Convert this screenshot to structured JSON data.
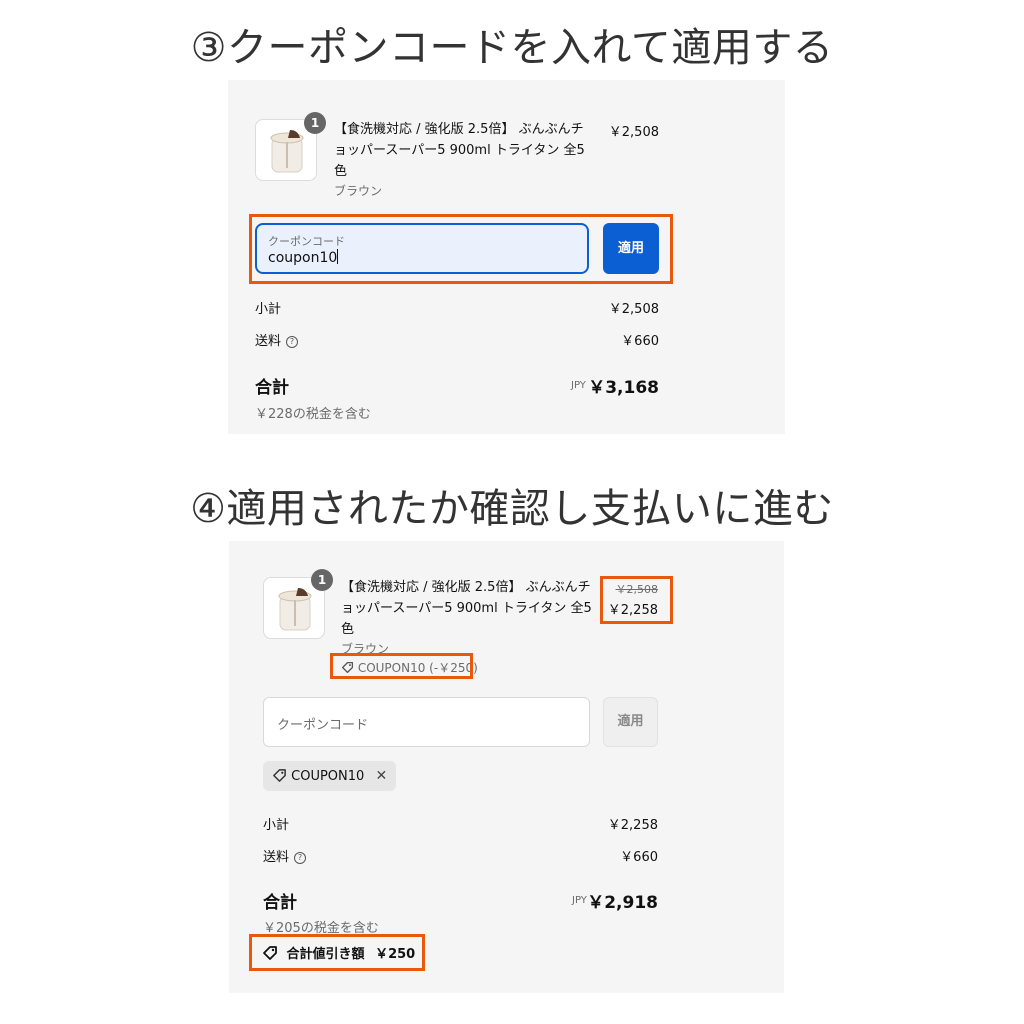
{
  "section1": {
    "heading": "③クーポンコードを入れて適用する",
    "product": {
      "quantity": "1",
      "name": "【食洗機対応 / 強化版 2.5倍】 ぶんぶんチョッパースーパー5 900ml トライタン 全5色",
      "variant": "ブラウン",
      "price": "￥2,508"
    },
    "coupon_field": {
      "label": "クーポンコード",
      "value": "coupon10"
    },
    "apply_button": "適用",
    "subtotal_label": "小計",
    "subtotal_value": "￥2,508",
    "shipping_label": "送料",
    "shipping_value": "￥660",
    "total_label": "合計",
    "currency": "JPY",
    "total_value": "￥3,168",
    "tax_note": "￥228の税金を含む"
  },
  "section2": {
    "heading": "④適用されたか確認し支払いに進む",
    "product": {
      "quantity": "1",
      "name": "【食洗機対応 / 強化版 2.5倍】 ぶんぶんチョッパースーパー5 900ml トライタン 全5色",
      "variant": "ブラウン",
      "original_price": "￥2,508",
      "discounted_price": "￥2,258",
      "discount_tag": "COUPON10 (-￥250)"
    },
    "coupon_placeholder": "クーポンコード",
    "apply_button": "適用",
    "applied_chip": "COUPON10",
    "subtotal_label": "小計",
    "subtotal_value": "￥2,258",
    "shipping_label": "送料",
    "shipping_value": "￥660",
    "total_label": "合計",
    "currency": "JPY",
    "total_value": "￥2,918",
    "tax_note": "￥205の税金を含む",
    "total_discount_label": "合計値引き額",
    "total_discount_value": "￥250"
  },
  "colors": {
    "accent_blue": "#0b5fd3",
    "highlight_orange": "#e8590c",
    "panel_bg": "#f5f5f5"
  },
  "icons": [
    "help-circle-icon",
    "tag-icon",
    "close-icon"
  ]
}
